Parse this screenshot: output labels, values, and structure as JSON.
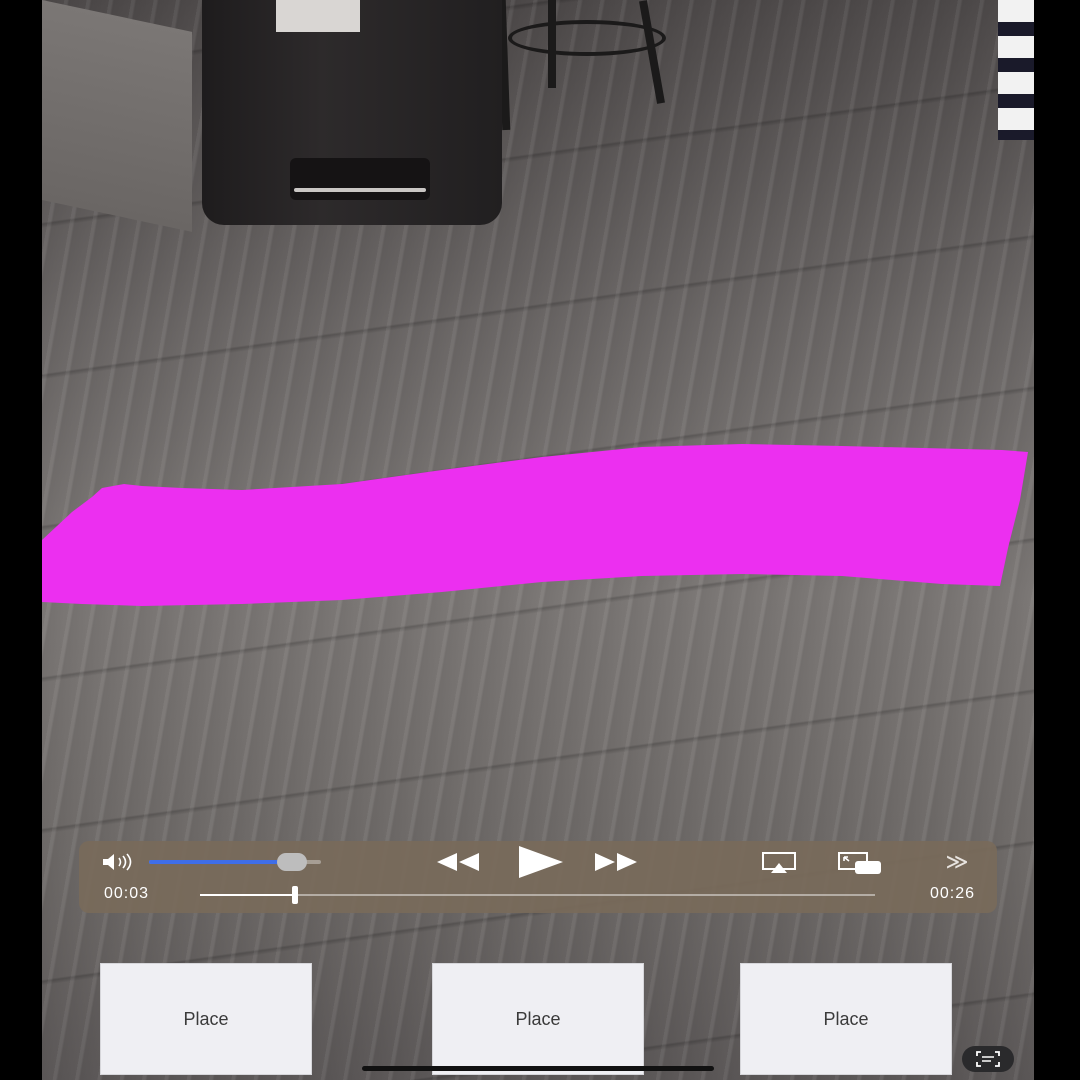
{
  "scene": {
    "stroke_color": "#ec2ff0",
    "floor_color": "#726e6c"
  },
  "player": {
    "volume_icon": "speaker-icon",
    "volume_level": 0.83,
    "rewind_icon": "rewind-icon",
    "play_icon": "play-icon",
    "forward_icon": "fast-forward-icon",
    "airplay_icon": "airplay-icon",
    "pip_icon": "picture-in-picture-icon",
    "more_icon": "chevron-double-right-icon",
    "more_label": "≫",
    "time_current": "00:03",
    "time_total": "00:26",
    "progress": 0.14,
    "accent_color": "#3f6ee8"
  },
  "actions": {
    "place_1": "Place",
    "place_2": "Place",
    "place_3": "Place"
  },
  "system": {
    "scan_icon": "text-scan-icon"
  }
}
